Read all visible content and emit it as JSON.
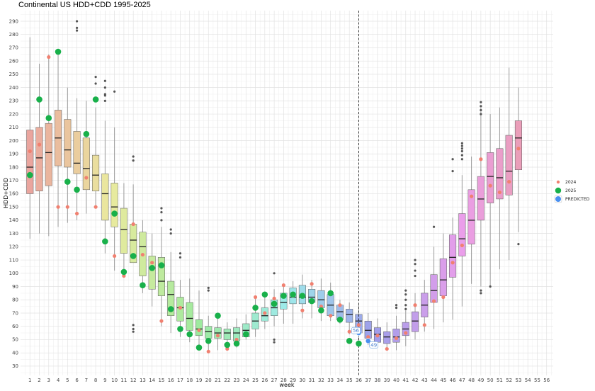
{
  "title": "Continental US HDD+CDD  1995-2025",
  "chart_data": {
    "type": "box",
    "title": "Continental US HDD+CDD  1995-2025",
    "xlabel": "week",
    "ylabel": "HDD+CDD",
    "x_ticks": [
      1,
      2,
      3,
      4,
      5,
      6,
      7,
      8,
      9,
      10,
      11,
      12,
      13,
      14,
      15,
      16,
      17,
      18,
      19,
      20,
      21,
      22,
      23,
      24,
      25,
      26,
      27,
      28,
      29,
      30,
      31,
      32,
      33,
      34,
      35,
      36,
      37,
      38,
      39,
      40,
      41,
      42,
      43,
      44,
      45,
      46,
      47,
      48,
      49,
      50,
      51,
      52,
      53,
      54,
      55,
      56
    ],
    "y_ticks": [
      30,
      40,
      50,
      60,
      70,
      80,
      90,
      100,
      110,
      120,
      130,
      140,
      150,
      160,
      170,
      180,
      190,
      200,
      210,
      220,
      230,
      240,
      250,
      260,
      270,
      280,
      290
    ],
    "xlim": [
      0,
      56.7
    ],
    "ylim": [
      23,
      298
    ],
    "vline_week": 36,
    "box_weeks": [
      1,
      2,
      3,
      4,
      5,
      6,
      7,
      8,
      9,
      10,
      11,
      12,
      13,
      14,
      15,
      16,
      17,
      18,
      19,
      20,
      21,
      22,
      23,
      24,
      25,
      26,
      27,
      28,
      29,
      30,
      31,
      32,
      33,
      34,
      35,
      36,
      37,
      38,
      39,
      40,
      41,
      42,
      43,
      44,
      45,
      46,
      47,
      48,
      49,
      50,
      51,
      52,
      53
    ],
    "box_stats": [
      [
        126,
        160,
        180,
        208,
        278
      ],
      [
        130,
        162,
        187,
        210,
        258
      ],
      [
        128,
        166,
        191,
        213,
        265
      ],
      [
        135,
        181,
        202,
        223,
        265
      ],
      [
        138,
        180,
        193,
        216,
        240
      ],
      [
        140,
        175,
        183,
        207,
        232
      ],
      [
        145,
        163,
        179,
        202,
        230
      ],
      [
        150,
        162,
        174,
        189,
        225
      ],
      [
        115,
        140,
        160,
        175,
        215
      ],
      [
        102,
        135,
        150,
        168,
        210
      ],
      [
        100,
        115,
        133,
        149,
        168
      ],
      [
        108,
        108,
        125,
        137,
        167
      ],
      [
        85,
        98,
        120,
        131,
        140
      ],
      [
        75,
        88,
        104,
        113,
        130
      ],
      [
        60,
        83,
        94,
        112,
        135
      ],
      [
        55,
        68,
        84,
        94,
        116
      ],
      [
        52,
        64,
        74,
        82,
        95
      ],
      [
        48,
        57,
        66,
        78,
        96
      ],
      [
        44,
        53,
        58,
        65,
        87
      ],
      [
        42,
        51,
        56,
        60,
        68
      ],
      [
        42,
        51,
        55,
        59,
        68
      ],
      [
        44,
        50,
        55,
        58,
        63
      ],
      [
        44,
        49,
        55,
        59,
        66
      ],
      [
        50,
        52,
        57,
        62,
        69
      ],
      [
        52,
        58,
        64,
        70,
        83
      ],
      [
        58,
        64,
        68,
        74,
        84
      ],
      [
        60,
        68,
        74,
        80,
        88
      ],
      [
        62,
        73,
        78,
        85,
        92
      ],
      [
        62,
        77,
        82,
        89,
        94
      ],
      [
        66,
        77,
        82,
        91,
        99
      ],
      [
        66,
        78,
        82,
        88,
        95
      ],
      [
        64,
        74,
        80,
        87,
        96
      ],
      [
        64,
        68,
        76,
        84,
        93
      ],
      [
        62,
        65,
        71,
        76,
        80
      ],
      [
        54,
        63,
        69,
        73,
        78
      ],
      [
        48,
        55,
        64,
        69,
        77
      ],
      [
        46,
        51,
        57,
        64,
        70
      ],
      [
        45,
        48,
        54,
        59,
        66
      ],
      [
        44,
        47,
        52,
        56,
        63
      ],
      [
        42,
        48,
        52,
        58,
        68
      ],
      [
        45,
        53,
        58,
        63,
        72
      ],
      [
        50,
        56,
        64,
        71,
        85
      ],
      [
        56,
        67,
        76,
        85,
        95
      ],
      [
        58,
        78,
        87,
        99,
        120
      ],
      [
        63,
        83,
        95,
        111,
        130
      ],
      [
        65,
        97,
        112,
        129,
        142
      ],
      [
        75,
        113,
        126,
        145,
        174
      ],
      [
        92,
        122,
        140,
        163,
        188
      ],
      [
        90,
        140,
        156,
        173,
        225
      ],
      [
        90,
        153,
        173,
        191,
        220
      ],
      [
        103,
        156,
        172,
        194,
        225
      ],
      [
        110,
        159,
        177,
        204,
        255
      ],
      [
        131,
        178,
        202,
        215,
        240
      ]
    ],
    "outliers": [
      {
        "week": 6,
        "values": [
          290,
          285,
          283
        ]
      },
      {
        "week": 8,
        "values": [
          248,
          243
        ]
      },
      {
        "week": 9,
        "values": [
          245,
          240,
          235,
          234,
          230
        ]
      },
      {
        "week": 10,
        "values": [
          237
        ]
      },
      {
        "week": 12,
        "values": [
          188,
          185,
          61,
          58,
          56
        ]
      },
      {
        "week": 15,
        "values": [
          149,
          146,
          140
        ]
      },
      {
        "week": 16,
        "values": [
          133,
          130
        ]
      },
      {
        "week": 17,
        "values": [
          115,
          112
        ]
      },
      {
        "week": 20,
        "values": [
          89,
          87
        ]
      },
      {
        "week": 27,
        "values": [
          100,
          50,
          48
        ]
      },
      {
        "week": 40,
        "values": [
          76,
          74
        ]
      },
      {
        "week": 41,
        "values": [
          87,
          84,
          80,
          76,
          73
        ]
      },
      {
        "week": 42,
        "values": [
          110,
          107,
          102,
          98
        ]
      },
      {
        "week": 44,
        "values": [
          135
        ]
      },
      {
        "week": 46,
        "values": [
          186,
          177
        ]
      },
      {
        "week": 47,
        "values": [
          198,
          196,
          194,
          192,
          189,
          186
        ]
      },
      {
        "week": 49,
        "values": [
          229,
          226,
          223,
          220,
          87,
          85
        ]
      },
      {
        "week": 50,
        "values": [
          90
        ]
      },
      {
        "week": 53,
        "values": [
          122
        ]
      }
    ],
    "series": [
      {
        "name": "2024",
        "color": "#f08070",
        "points": [
          [
            1,
            192
          ],
          [
            2,
            197
          ],
          [
            3,
            263
          ],
          [
            4,
            150
          ],
          [
            5,
            150
          ],
          [
            6,
            145
          ],
          [
            7,
            172
          ],
          [
            8,
            150
          ],
          [
            9,
            125
          ],
          [
            10,
            113
          ],
          [
            11,
            98
          ],
          [
            12,
            137
          ],
          [
            13,
            114
          ],
          [
            14,
            108
          ],
          [
            15,
            64
          ],
          [
            16,
            72
          ],
          [
            17,
            74
          ],
          [
            18,
            55
          ],
          [
            19,
            57
          ],
          [
            20,
            41
          ],
          [
            21,
            53
          ],
          [
            22,
            43
          ],
          [
            23,
            50
          ],
          [
            24,
            54
          ],
          [
            25,
            82
          ],
          [
            26,
            70
          ],
          [
            27,
            81
          ],
          [
            28,
            91
          ],
          [
            29,
            83
          ],
          [
            30,
            72
          ],
          [
            31,
            92
          ],
          [
            32,
            75
          ],
          [
            33,
            68
          ],
          [
            34,
            76
          ],
          [
            35,
            56
          ],
          [
            36,
            61
          ],
          [
            37,
            52
          ],
          [
            38,
            53
          ],
          [
            39,
            43
          ],
          [
            40,
            51
          ],
          [
            41,
            55
          ],
          [
            42,
            76
          ],
          [
            43,
            61
          ],
          [
            44,
            79
          ],
          [
            45,
            82
          ],
          [
            46,
            108
          ],
          [
            47,
            121
          ],
          [
            48,
            158
          ],
          [
            49,
            186
          ],
          [
            50,
            166
          ],
          [
            51,
            161
          ],
          [
            52,
            169
          ],
          [
            53,
            194
          ]
        ]
      },
      {
        "name": "2025",
        "color": "#18b04a",
        "points": [
          [
            1,
            174
          ],
          [
            2,
            231
          ],
          [
            3,
            217
          ],
          [
            4,
            267
          ],
          [
            5,
            169
          ],
          [
            6,
            163
          ],
          [
            7,
            205
          ],
          [
            8,
            231
          ],
          [
            9,
            124
          ],
          [
            10,
            145
          ],
          [
            11,
            101
          ],
          [
            12,
            113
          ],
          [
            13,
            91
          ],
          [
            14,
            104
          ],
          [
            15,
            106
          ],
          [
            16,
            73
          ],
          [
            17,
            58
          ],
          [
            18,
            54
          ],
          [
            19,
            44
          ],
          [
            20,
            49
          ],
          [
            21,
            68
          ],
          [
            22,
            46
          ],
          [
            23,
            47
          ],
          [
            24,
            54
          ],
          [
            25,
            74
          ],
          [
            26,
            84
          ],
          [
            27,
            77
          ],
          [
            28,
            83
          ],
          [
            29,
            84
          ],
          [
            30,
            83
          ],
          [
            31,
            79
          ],
          [
            32,
            72
          ],
          [
            33,
            85
          ],
          [
            34,
            65
          ],
          [
            35,
            49
          ],
          [
            36,
            47
          ]
        ]
      },
      {
        "name": "PREDICTED",
        "color": "#4a90f0",
        "points": [
          [
            36,
            55
          ],
          [
            37,
            49
          ]
        ],
        "labels": [
          [
            36,
            56,
            "56"
          ],
          [
            37,
            49,
            "49"
          ]
        ]
      }
    ],
    "legend": [
      "2024",
      "2025",
      "PREDICTED"
    ],
    "legend_title": "",
    "legend_position": "right",
    "grid": true
  }
}
